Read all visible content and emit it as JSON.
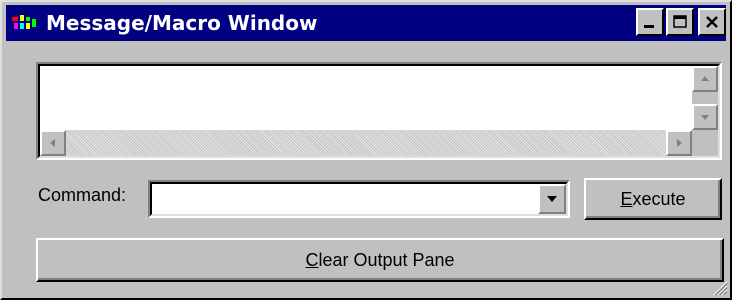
{
  "window": {
    "title": "Message/Macro Window",
    "accent_color": "#000080",
    "icons": {
      "app": "app-icon",
      "minimize": "minimize-icon",
      "maximize": "maximize-icon",
      "close": "close-icon"
    }
  },
  "output_pane": {
    "content": "",
    "icons": {
      "scroll_up": "arrow-up-icon",
      "scroll_down": "arrow-down-icon",
      "scroll_left": "arrow-left-icon",
      "scroll_right": "arrow-right-icon"
    }
  },
  "command": {
    "label": "Command:",
    "value": "",
    "dropdown_icon": "chevron-down-icon"
  },
  "buttons": {
    "execute": {
      "mnemonic": "E",
      "rest": "xecute"
    },
    "clear": {
      "mnemonic": "C",
      "rest": "lear Output Pane"
    }
  },
  "status": {
    "grip_icon": "resize-grip-icon"
  }
}
